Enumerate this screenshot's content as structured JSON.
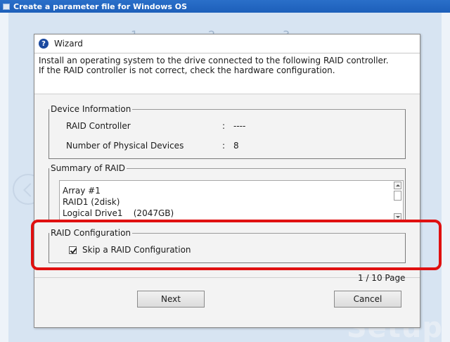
{
  "window": {
    "title": "Create a parameter file for Windows OS",
    "step_marks": [
      "1",
      "2",
      "3"
    ]
  },
  "background": {
    "watermark": "Setup"
  },
  "dialog": {
    "title": "Wizard",
    "intro_line1": "Install an operating system to the drive connected to the following RAID controller.",
    "intro_line2": "If the RAID controller is not correct, check the hardware configuration.",
    "device_info": {
      "legend": "Device Information",
      "rows": [
        {
          "label": "RAID Controller",
          "separator": ":",
          "value": "----"
        },
        {
          "label": "Number of Physical Devices",
          "separator": ":",
          "value": "8"
        }
      ]
    },
    "raid_summary": {
      "legend": "Summary of RAID",
      "lines": [
        "Array #1",
        "RAID1 (2disk)",
        "Logical Drive1    (2047GB)"
      ]
    },
    "raid_config": {
      "legend": "RAID Configuration",
      "checkbox_label": "Skip a RAID Configuration",
      "checked": true
    },
    "page_indicator": "1 / 10 Page",
    "buttons": {
      "next": "Next",
      "cancel": "Cancel"
    }
  },
  "colors": {
    "titlebar": "#1d5fba",
    "highlight": "#e01010",
    "backdrop": "#d7e4f2"
  }
}
